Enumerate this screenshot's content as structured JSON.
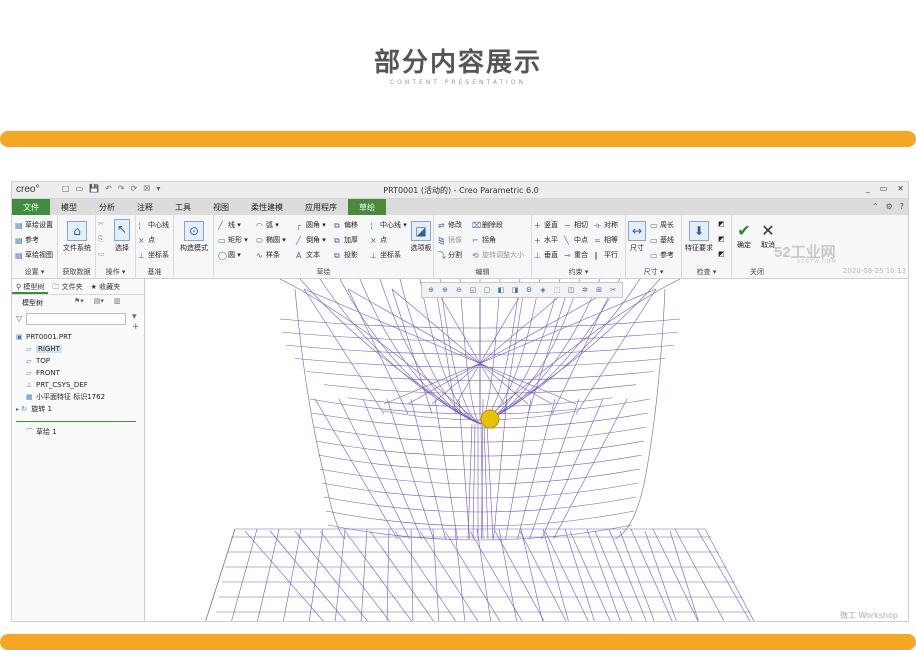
{
  "hero": {
    "title": "部分内容展示",
    "subtitle": "CONTENT PRESENTATION"
  },
  "colors": {
    "accent_bar": "#f5a623",
    "ribbon_tab_active": "#4b8a3b",
    "wireframe": "#5a3fb8"
  },
  "window": {
    "logo": "creo°",
    "title": "PRT0001 (活动的) - Creo Parametric 6.0",
    "quick_access": [
      "□",
      "▭",
      "💾",
      "↶",
      "↷",
      "⟳",
      "☒",
      "▾"
    ],
    "controls": [
      "_",
      "▭",
      "✕"
    ]
  },
  "tabs": [
    {
      "label": "文件"
    },
    {
      "label": "模型"
    },
    {
      "label": "分析"
    },
    {
      "label": "注释"
    },
    {
      "label": "工具"
    },
    {
      "label": "视图"
    },
    {
      "label": "柔性建模"
    },
    {
      "label": "应用程序"
    },
    {
      "label": "草绘"
    }
  ],
  "ribbon": {
    "settings": {
      "items": [
        "草绘设置",
        "参考",
        "草绘视图"
      ],
      "label": "设置 ▾"
    },
    "data": {
      "big": "文件系统",
      "label": "获取数据"
    },
    "ops": {
      "big": "选择",
      "label": "操作 ▾"
    },
    "datum": {
      "items": [
        "中心线",
        "点",
        "坐标系"
      ],
      "label": "基准"
    },
    "construct": {
      "big": "构造模式"
    },
    "sketch": {
      "col1": [
        "线 ▾",
        "矩形 ▾",
        "圆 ▾"
      ],
      "col2": [
        "弧 ▾",
        "椭圆 ▾",
        "样条"
      ],
      "col3": [
        "圆角 ▾",
        "倒角 ▾",
        "文本"
      ],
      "col4": [
        "偏移",
        "加厚",
        "投影"
      ],
      "col5": [
        "中心线 ▾",
        "点",
        "坐标系"
      ],
      "big": "选项板",
      "label": "草绘"
    },
    "edit": {
      "col1": [
        "修改",
        "镜像",
        "分割"
      ],
      "col2": [
        "删除段",
        "拐角",
        "旋转调整大小"
      ],
      "label": "编辑"
    },
    "constraint": {
      "col1": [
        "竖直",
        "水平",
        "垂直"
      ],
      "col2": [
        "相切",
        "中点",
        "重合"
      ],
      "col3": [
        "对称",
        "相等",
        "平行"
      ],
      "label": "约束 ▾"
    },
    "dimension": {
      "big": "尺寸",
      "col": [
        "周长",
        "基线",
        "参考"
      ],
      "label": "尺寸 ▾"
    },
    "inspect": {
      "big": "特征要求",
      "label": "检查 ▾"
    },
    "close": {
      "ok": "确定",
      "cancel": "取消",
      "label": "关闭"
    },
    "brand": "52工业网",
    "brand_url": "52GYW.COM",
    "watermark": "2020-08-25 10:13"
  },
  "sidebar": {
    "tabs": [
      "模型树",
      "文件夹",
      "收藏夹"
    ],
    "header": "模型树",
    "filter_placeholder": "",
    "tree": [
      {
        "label": "PRT0001.PRT",
        "icon": "▣",
        "indent": 0
      },
      {
        "label": "RIGHT",
        "icon": "▱",
        "indent": 1,
        "selected": true
      },
      {
        "label": "TOP",
        "icon": "▱",
        "indent": 1
      },
      {
        "label": "FRONT",
        "icon": "▱",
        "indent": 1
      },
      {
        "label": "PRT_CSYS_DEF",
        "icon": "⊥",
        "indent": 1
      },
      {
        "label": "小平面特征 标识1762",
        "icon": "▦",
        "indent": 1
      },
      {
        "label": "旋转 1",
        "icon": "↻",
        "indent": 0,
        "expand": "▸"
      }
    ],
    "sketch_node": {
      "label": "草绘 1",
      "icon": "⌒"
    }
  },
  "viewport": {
    "toolbar_icons": [
      "⊕",
      "⊕",
      "⊖",
      "◱",
      "▢",
      "◧",
      "◨",
      "⚙",
      "◈",
      "⬚",
      "◫",
      "✲",
      "⊞",
      "✂"
    ],
    "corner_text": "微工 Workshop"
  }
}
